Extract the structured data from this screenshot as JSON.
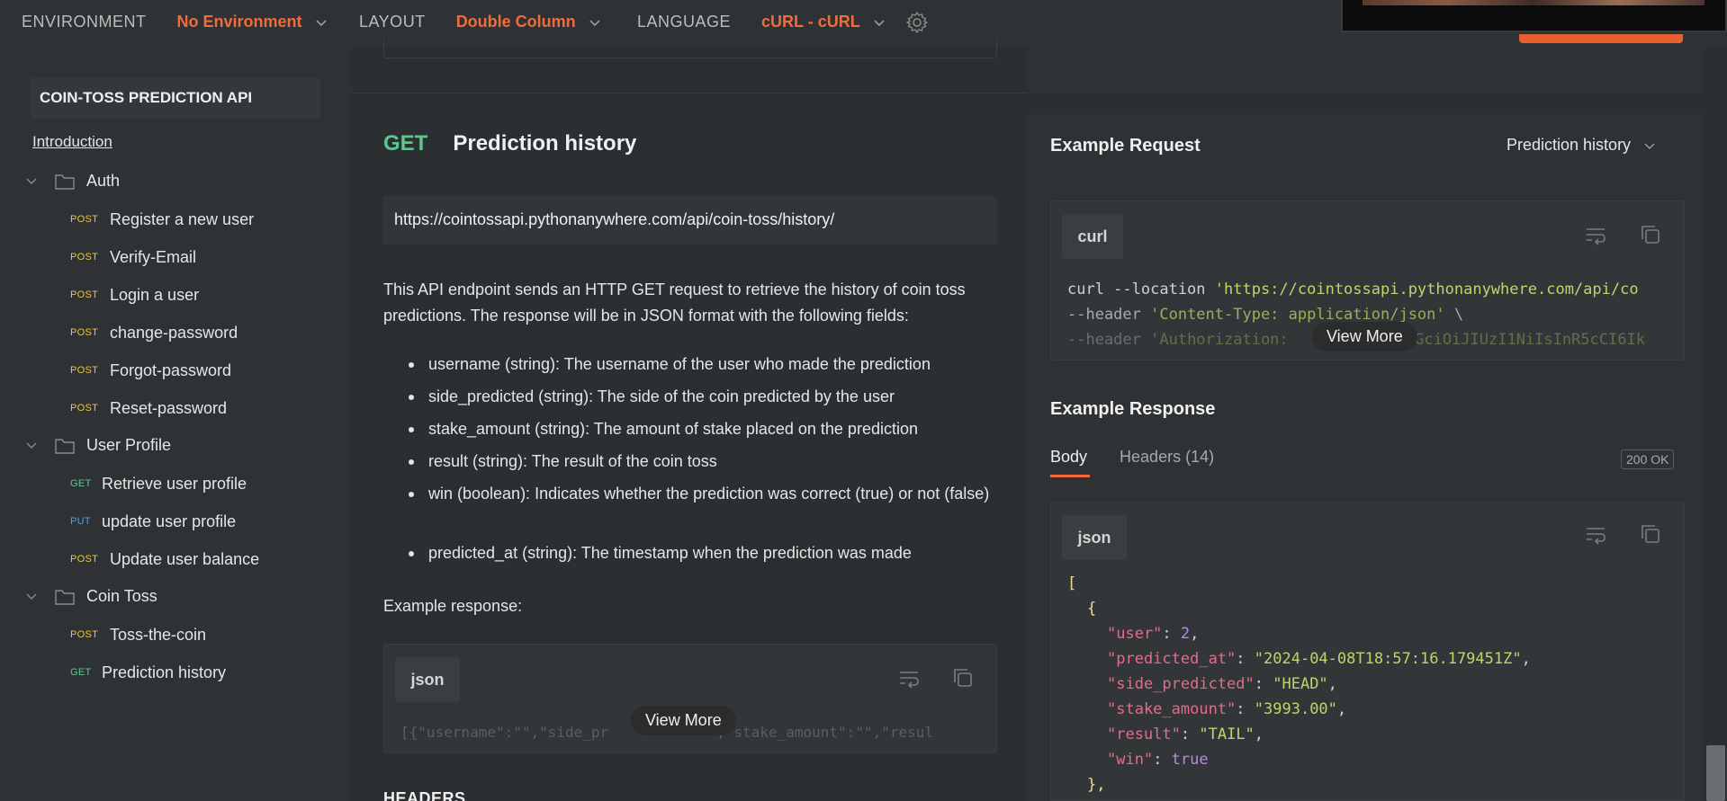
{
  "topbar": {
    "environment_label": "ENVIRONMENT",
    "environment_value": "No Environment",
    "layout_label": "LAYOUT",
    "layout_value": "Double Column",
    "language_label": "LANGUAGE",
    "language_value": "cURL - cURL"
  },
  "sidebar": {
    "collection_title": "COIN-TOSS PREDICTION API",
    "intro": "Introduction",
    "folders": [
      {
        "label": "Auth"
      },
      {
        "label": "User Profile"
      },
      {
        "label": "Coin Toss"
      }
    ],
    "items": [
      {
        "method": "POST",
        "label": "Register a new user"
      },
      {
        "method": "POST",
        "label": "Verify-Email"
      },
      {
        "method": "POST",
        "label": "Login a user"
      },
      {
        "method": "POST",
        "label": "change-password"
      },
      {
        "method": "POST",
        "label": "Forgot-password"
      },
      {
        "method": "POST",
        "label": "Reset-password"
      },
      {
        "method": "GET",
        "label": "Retrieve user profile"
      },
      {
        "method": "PUT",
        "label": "update user profile"
      },
      {
        "method": "POST",
        "label": "Update user balance"
      },
      {
        "method": "POST",
        "label": "Toss-the-coin"
      },
      {
        "method": "GET",
        "label": "Prediction history"
      }
    ]
  },
  "request": {
    "method": "GET",
    "name": "Prediction history",
    "url": "https://cointossapi.pythonanywhere.com/api/coin-toss/history/",
    "description": "This API endpoint sends an HTTP GET request to retrieve the history of coin toss predictions. The response will be in JSON format with the following fields:",
    "fields": [
      "username (string): The username of the user who made the prediction",
      "side_predicted (string): The side of the coin predicted by the user",
      "stake_amount (string): The amount of stake placed on the prediction",
      "result (string): The result of the coin toss",
      "win (boolean): Indicates whether the prediction was correct (true) or not (false)",
      "predicted_at (string): The timestamp when the prediction was made"
    ],
    "example_label": "Example response:",
    "example_lang": "json",
    "example_code": "[{\"username\":\"\",\"side_pr",
    "example_code_tail": ",\"stake_amount\":\"\",\"resul",
    "view_more": "View More",
    "headers_heading": "HEADERS"
  },
  "example_request": {
    "title": "Example Request",
    "selected": "Prediction history",
    "lang": "curl",
    "line1_plain": "curl --location ",
    "line1_str": "'https://cointossapi.pythonanywhere.com/api/co",
    "line2_plain": "--header ",
    "line2_str": "'Content-Type: application/json'",
    "line2_tail": " \\",
    "line3_plain": "--header ",
    "line3_str": "'Authorization: ",
    "line3_tail": "bGciOiJIUzI1NiIsInR5cCI6Ik",
    "view_more": "View More"
  },
  "example_response": {
    "title": "Example Response",
    "tab_body": "Body",
    "tab_headers": "Headers (14)",
    "status": "200 OK",
    "lang": "json",
    "json": {
      "user": "2",
      "predicted_at": "\"2024-04-08T18:57:16.179451Z\"",
      "side_predicted": "\"HEAD\"",
      "stake_amount": "\"3993.00\"",
      "result": "\"TAIL\"",
      "win": "true"
    }
  },
  "colors": {
    "accent": "#f26b3a",
    "get": "#5cc68e",
    "post": "#e8c44c",
    "put": "#5a9ee6"
  }
}
